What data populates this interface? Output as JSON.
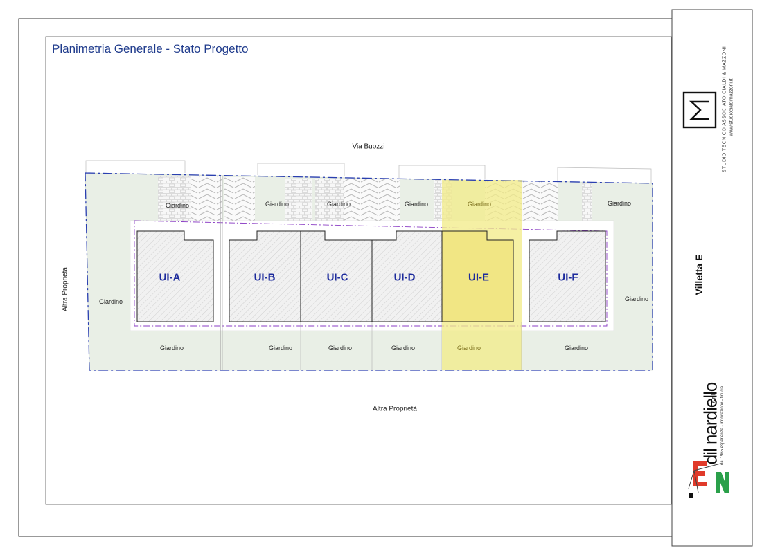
{
  "title": "Planimetria Generale - Stato Progetto",
  "street_label": "Via Buozzi",
  "property_left": "Altra Proprietà",
  "property_bottom": "Altra Proprietà",
  "villa_label": "Villetta E",
  "units": [
    {
      "id": "UI-A",
      "highlighted": false
    },
    {
      "id": "UI-B",
      "highlighted": false
    },
    {
      "id": "UI-C",
      "highlighted": false
    },
    {
      "id": "UI-D",
      "highlighted": false
    },
    {
      "id": "UI-E",
      "highlighted": true
    },
    {
      "id": "UI-F",
      "highlighted": false
    }
  ],
  "garden_label": "Giardino",
  "studio": {
    "name": "STUDIO TECNICO ASSOCIATO CIALDI & MAZZONI",
    "website": "www.studiocialdimazzoni.it"
  },
  "brand": {
    "name": "dil nardiello",
    "suffix": "s.r.l.",
    "tagline": "dal 1965 esperienza - innovazione - fiducia"
  },
  "colors": {
    "title": "#1f3b8c",
    "unit_label": "#1c2a9c",
    "garden": "#e9efe6",
    "highlight": "#f2ec8a",
    "boundary": "#2a3fb0",
    "offset_line": "#8a3cc4",
    "brand_red": "#e03a2a",
    "brand_green": "#2aa04a"
  }
}
